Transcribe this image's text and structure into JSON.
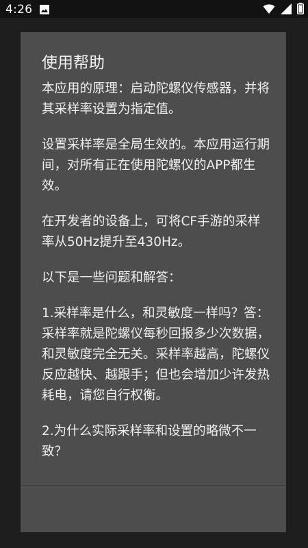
{
  "status_bar": {
    "time": "4:26",
    "icons": [
      "image-icon",
      "wifi-icon",
      "signal-icon",
      "battery-icon"
    ]
  },
  "dialog": {
    "title": "使用帮助",
    "paragraphs": [
      "本应用的原理：启动陀螺仪传感器，并将其采样率设置为指定值。",
      "设置采样率是全局生效的。本应用运行期间，对所有正在使用陀螺仪的APP都生效。",
      "在开发者的设备上，可将CF手游的采样率从50Hz提升至430Hz。",
      "以下是一些问题和解答：",
      "1.采样率是什么，和灵敏度一样吗？答：采样率就是陀螺仪每秒回报多少次数据，和灵敏度完全无关。采样率越高，陀螺仪反应越快、越跟手；但也会增加少许发热耗电，请您自行权衡。",
      "2.为什么实际采样率和设置的略微不一致？"
    ]
  },
  "colors": {
    "dialog_bg": "#4d4d4d",
    "backdrop": "#1e1e1e",
    "status_bar_bg": "#121212",
    "text": "#efefef"
  }
}
